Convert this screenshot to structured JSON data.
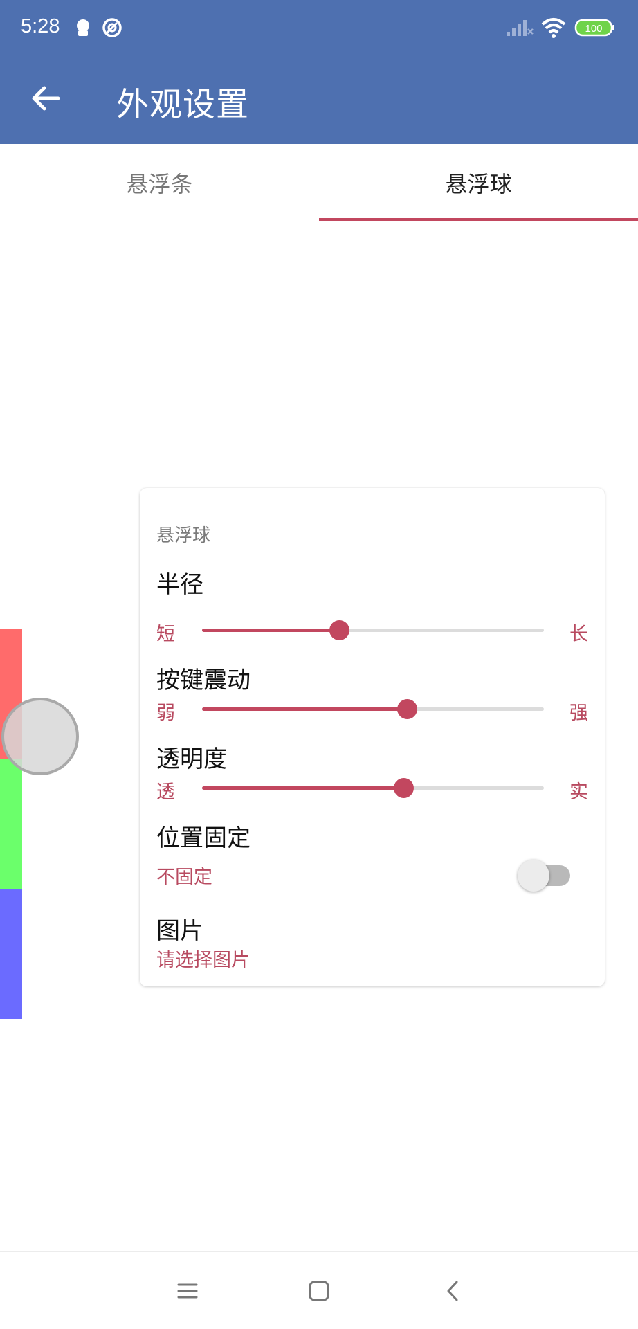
{
  "status_bar": {
    "time": "5:28",
    "battery": "100",
    "icons": [
      "notification-icon",
      "sync-icon",
      "signal-icon",
      "wifi-icon",
      "battery-icon"
    ]
  },
  "app_bar": {
    "title": "外观设置",
    "back_icon": "arrow-left-icon"
  },
  "tabs": [
    {
      "label": "悬浮条",
      "selected": false
    },
    {
      "label": "悬浮球",
      "selected": true
    }
  ],
  "card": {
    "header": "悬浮球",
    "radius": {
      "label": "半径",
      "min_label": "短",
      "max_label": "长",
      "value": 0.4
    },
    "vibration": {
      "label": "按键震动",
      "min_label": "弱",
      "max_label": "强",
      "value": 0.6
    },
    "opacity": {
      "label": "透明度",
      "min_label": "透",
      "max_label": "实",
      "value": 0.59
    },
    "position_fixed": {
      "label": "位置固定",
      "status": "不固定",
      "enabled": false
    },
    "image": {
      "label": "图片",
      "status": "请选择图片"
    }
  },
  "preview": {
    "bar_colors": [
      "#ff6b6b",
      "#6bff6b",
      "#6b6bff"
    ],
    "ball_color": "#d7d7d7"
  },
  "colors": {
    "primary": "#4e70b0",
    "accent": "#c2475f"
  },
  "nav_bar": {
    "icons": [
      "menu-icon",
      "home-icon",
      "back-icon"
    ]
  }
}
